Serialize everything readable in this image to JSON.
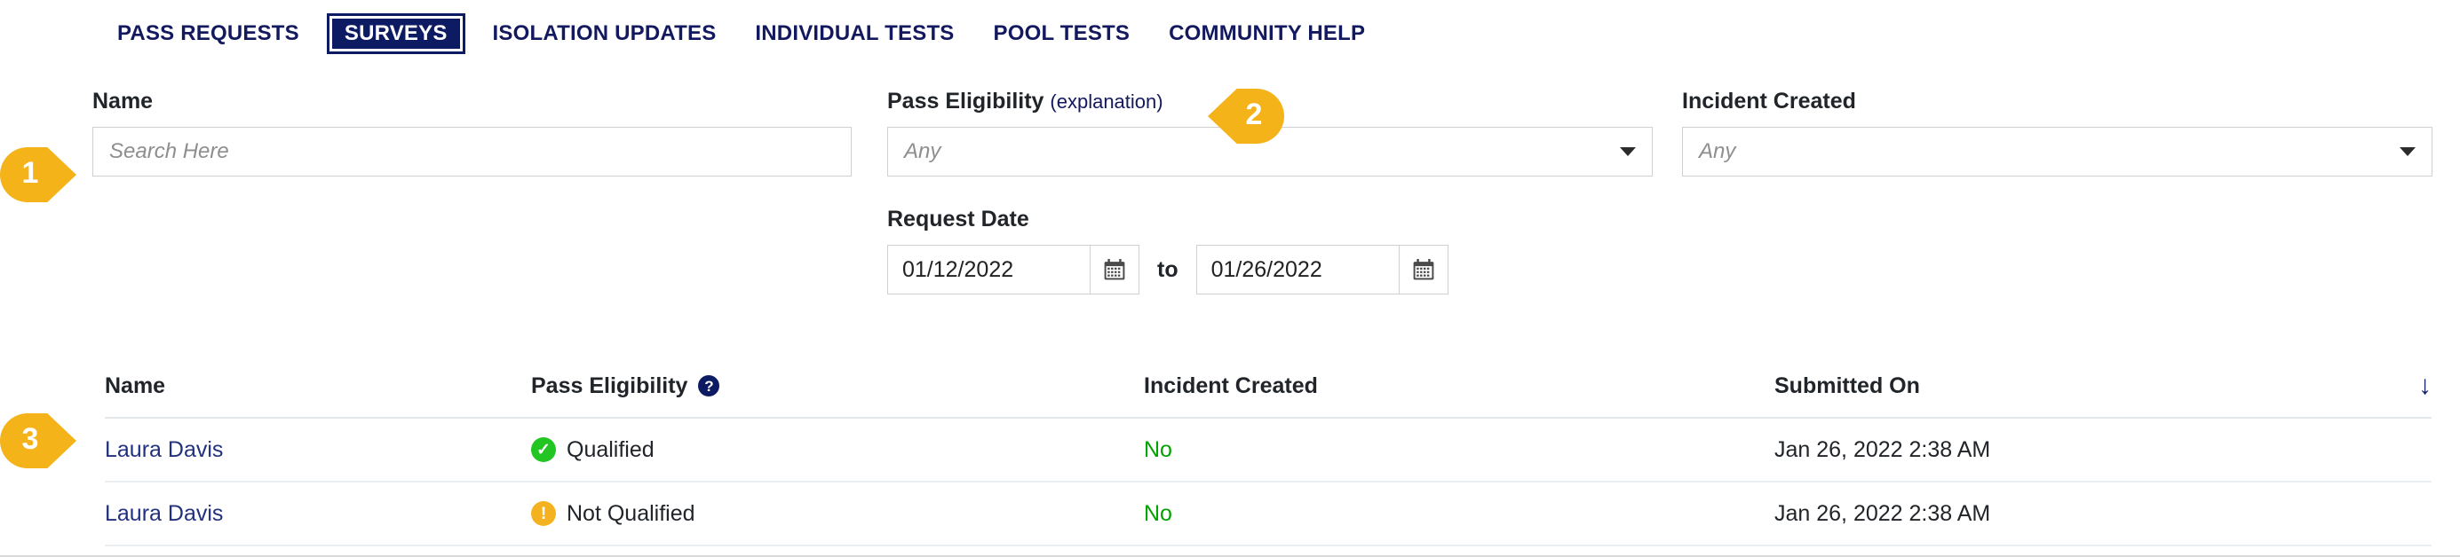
{
  "nav": {
    "items": [
      {
        "label": "PASS REQUESTS",
        "active": false
      },
      {
        "label": "SURVEYS",
        "active": true
      },
      {
        "label": "ISOLATION UPDATES",
        "active": false
      },
      {
        "label": "INDIVIDUAL TESTS",
        "active": false
      },
      {
        "label": "POOL TESTS",
        "active": false
      },
      {
        "label": "COMMUNITY HELP",
        "active": false
      }
    ]
  },
  "filters": {
    "name": {
      "label": "Name",
      "placeholder": "Search Here",
      "value": ""
    },
    "pass_eligibility": {
      "label": "Pass Eligibility",
      "explanation_link": "(explanation)",
      "value": "Any",
      "caret_icon": "chevron-down-icon"
    },
    "request_date": {
      "label": "Request Date",
      "from": "01/12/2022",
      "to_label": "to",
      "to": "01/26/2022",
      "calendar_icon": "calendar-icon"
    },
    "incident_created": {
      "label": "Incident Created",
      "value": "Any",
      "caret_icon": "chevron-down-icon"
    }
  },
  "table": {
    "columns": [
      {
        "label": "Name",
        "help": false
      },
      {
        "label": "Pass Eligibility",
        "help": true,
        "help_icon": "question-circle-icon"
      },
      {
        "label": "Incident Created",
        "help": false
      },
      {
        "label": "Submitted On",
        "help": false
      }
    ],
    "sort_icon": "↓",
    "rows": [
      {
        "name": "Laura Davis",
        "eligibility": "Qualified",
        "eligibility_icon": "check-circle-icon",
        "eligibility_state": "qualified",
        "incident_created": "No",
        "submitted_on": "Jan 26, 2022 2:38 AM"
      },
      {
        "name": "Laura Davis",
        "eligibility": "Not Qualified",
        "eligibility_icon": "exclamation-circle-icon",
        "eligibility_state": "not-qualified",
        "incident_created": "No",
        "submitted_on": "Jan 26, 2022 2:38 AM"
      }
    ]
  },
  "callouts": [
    {
      "number": "1",
      "direction": "right"
    },
    {
      "number": "2",
      "direction": "left"
    },
    {
      "number": "3",
      "direction": "right"
    }
  ],
  "colors": {
    "brand_navy": "#0d1b63",
    "accent_amber": "#f5b31a",
    "status_green": "#22c522",
    "status_warn": "#f5b220",
    "link_navy": "#22317e",
    "value_green": "#00a300"
  }
}
